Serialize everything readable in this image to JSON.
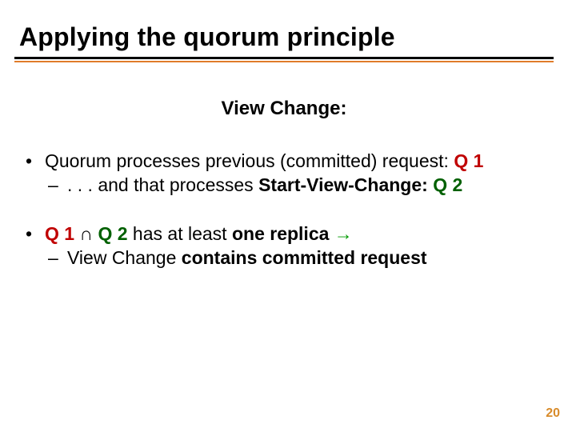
{
  "title": "Applying the quorum principle",
  "subtitle": "View Change:",
  "b1": {
    "pre": "Quorum processes previous (committed) request: ",
    "q1": "Q 1"
  },
  "b1s": {
    "pre": ". . . and that processes ",
    "svc": "Start-View-Change: ",
    "q2": "Q 2"
  },
  "b2": {
    "q1": "Q 1",
    "cap": " ∩ ",
    "q2": "Q 2",
    "mid": " has at least ",
    "one": "one replica ",
    "arrow": "→"
  },
  "b2s": {
    "pre": "View Change ",
    "bold": "contains committed request"
  },
  "page": "20",
  "bullet": "•",
  "dash": "–"
}
